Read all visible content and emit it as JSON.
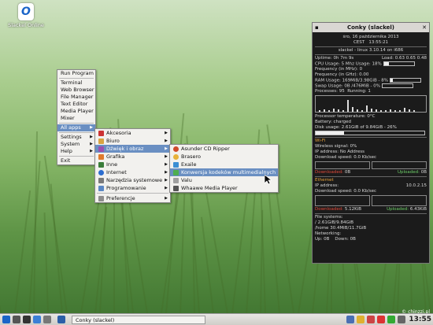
{
  "desktop": {
    "icon_label": "Slackel Online"
  },
  "root_menu": {
    "items": [
      "Run Program",
      "Terminal",
      "Web Browser",
      "File Manager",
      "Text Editor",
      "Media Player",
      "Mixer",
      "All apps",
      "Settings",
      "System",
      "Help",
      "Exit"
    ]
  },
  "apps_menu": {
    "items": [
      "Akcesoria",
      "Biuro",
      "Dźwięk i obraz",
      "Grafika",
      "Inne",
      "Internet",
      "Narzędzia systemowe",
      "Programowanie",
      "Preferencje"
    ]
  },
  "sound_menu": {
    "items": [
      "Asunder CD Ripper",
      "Brasero",
      "Exaile",
      "Konwersja kodeków multimedialnych",
      "Valu",
      "Whaawe Media Player"
    ]
  },
  "conky": {
    "title": "Conky (slackel)",
    "date": "śro, 16 października 2013",
    "tz": "CEST",
    "time": "13:55:21",
    "kernel": "slackel - linux 3.10.14 on i686",
    "uptime_label": "Uptime: 0h 7m 9s",
    "load_label": "Load: 0.63 0.65 0.48",
    "cpu_label": "CPU Usage:",
    "cpu_val": "5 Mhz",
    "cpu_pct_label": "Usage: 18%",
    "cpu_pct": 0.18,
    "freq1": "Frequency (in MHz): 0",
    "freq2": "Frequency (in GHz): 0.00",
    "ram_label": "RAM Usage: 169MiB/3.98GiB - 8%",
    "ram_pct": 0.08,
    "swap_label": "Swap Usage: 0B /476MiB - 0%",
    "swap_pct": 0.0,
    "proc": "Processes: 95",
    "running": "Running: 1",
    "cpu_temp": "Processor temperature: 0°C",
    "battery": "Battery: charged",
    "disk": "Disk usage: 2.61GiB of 9.84GiB - 26%",
    "disk_pct": 0.26,
    "wifi_head": "Wi-Fi",
    "wifi_signal": "Wireless signal: 0%",
    "wifi_ip": "IP address: No Address",
    "wifi_down": "Download speed: 0.0 Kb/sec",
    "wifi_dl": "Downloaded:",
    "wifi_dl_val": "0B",
    "wifi_ul": "Uploaded:",
    "wifi_ul_val": "0B",
    "eth_head": "Ethernet",
    "eth_ip_label": "IP address:",
    "eth_ip": "10.0.2.15",
    "eth_down": "Download speed: 0.0 Kb/sec",
    "eth_dl": "Downloaded:",
    "eth_dl_val": "5.12KiB",
    "eth_ul": "Uploaded:",
    "eth_ul_val": "6.43KiB",
    "fs_head": "File systems:",
    "fs_root": "/ 2.61GiB/9.84GiB",
    "fs_home": "/home 30.4MiB/11.7GiB",
    "net_head": "Networking:",
    "net_up": "Up: 0B",
    "net_down": "Down: 0B"
  },
  "taskbar": {
    "task": "Conky (slackel)",
    "clock": "13:55",
    "watermark": "© chinzzi.pl"
  }
}
